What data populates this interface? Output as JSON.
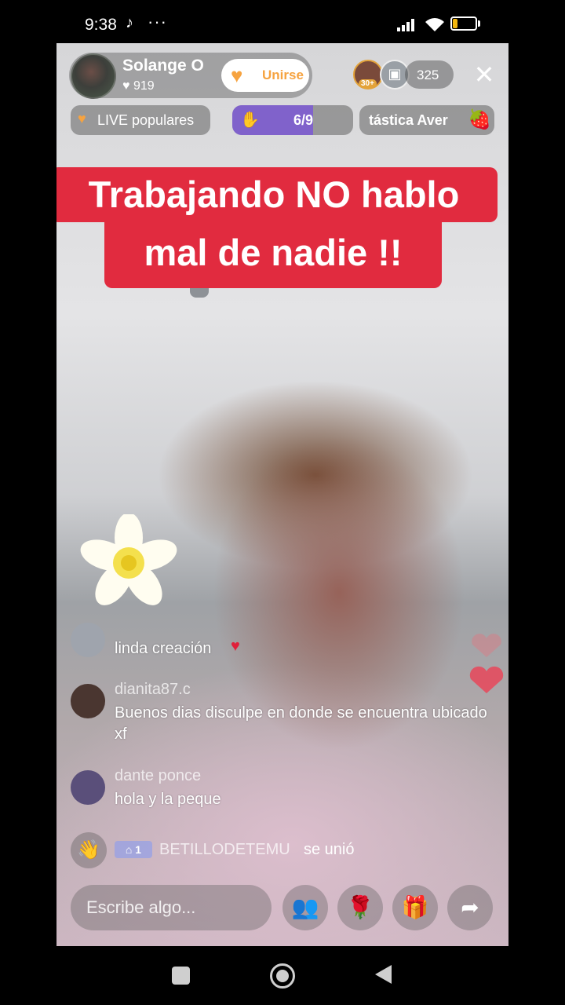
{
  "status_bar": {
    "time": "9:38",
    "tiktok_icon": "tiktok-icon",
    "more": "···",
    "battery": "21",
    "battery_level": 0.21,
    "battery_color": "#f2b60e"
  },
  "header": {
    "host_name": "Solange O",
    "likes": "♥ 919",
    "join_label": "Unirse",
    "viewer_badge": "30+",
    "viewer_count": "325",
    "close": "✕"
  },
  "banners": {
    "popular_label": "LIVE populares",
    "progress_label": "6/9",
    "progress_value": 0.67,
    "ticker_label": "tástica    Aver"
  },
  "caption": {
    "line1": "Trabajando NO hablo",
    "line2": "mal de nadie !!",
    "color": "#e12b3f"
  },
  "comments": [
    {
      "user": "",
      "text": "linda creación"
    },
    {
      "user": "dianita87.c",
      "text": "Buenos dias disculpe en donde se encuentra ubicado xf"
    },
    {
      "user": "dante ponce",
      "text": "hola y la peque"
    }
  ],
  "join_event": {
    "badge": "1",
    "user": "BETILLODETEMU",
    "verb": "se unió"
  },
  "composer": {
    "placeholder": "Escribe algo..."
  },
  "actions": [
    "people-icon",
    "rose-icon",
    "gift-icon",
    "share-icon"
  ]
}
